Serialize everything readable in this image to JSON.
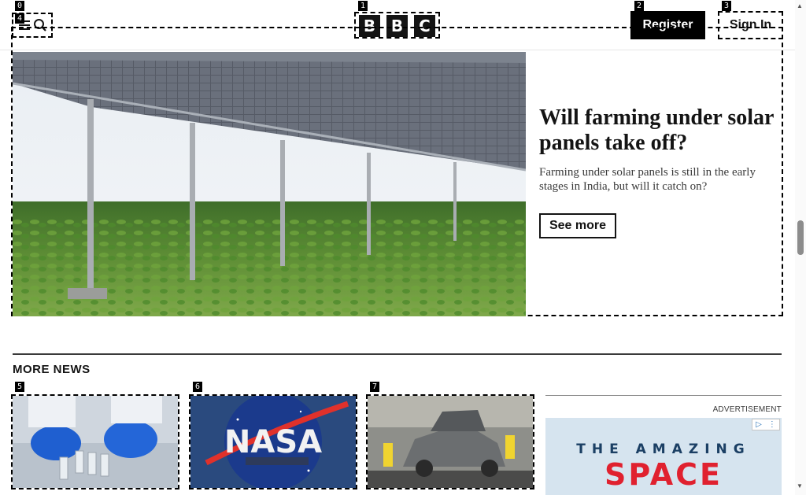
{
  "header": {
    "logo_letters": [
      "B",
      "B",
      "C"
    ],
    "register_label": "Register",
    "signin_label": "Sign In",
    "menu_icon": "hamburger-icon",
    "search_icon": "search-icon"
  },
  "feature": {
    "title": "Will farming under solar panels take off?",
    "summary": "Farming under solar panels is still in the early stages in India, but will it catch on?",
    "button_label": "See more",
    "image": "solar-panels-over-crops-image"
  },
  "more_news": {
    "title": "MORE NEWS",
    "cards": [
      {
        "image": "gloved-hands-vials-image"
      },
      {
        "image": "nasa-logo-image",
        "logo_text": "NASA"
      },
      {
        "image": "car-factory-image"
      }
    ]
  },
  "advertisement": {
    "label": "ADVERTISEMENT",
    "line1": "THE AMAZING",
    "line2": "SPACE"
  },
  "markers": [
    "0",
    "1",
    "2",
    "3",
    "4",
    "5",
    "6",
    "7"
  ],
  "colors": {
    "text": "#141414",
    "ad_red": "#e0212f",
    "ad_blue": "#1b3f64"
  }
}
